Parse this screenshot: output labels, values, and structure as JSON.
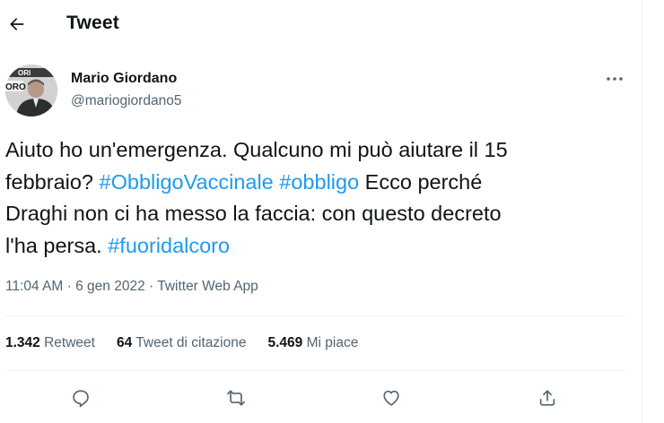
{
  "header": {
    "title": "Tweet",
    "back_icon": "arrow-left-icon"
  },
  "author": {
    "name": "Mario Giordano",
    "handle": "@mariogiordano5",
    "avatar_text_top": "ORI",
    "avatar_text_bottom": "ORO"
  },
  "tweet": {
    "line1": "Aiuto ho un'emergenza. Qualcuno mi può aiutare il 15",
    "line2_pre": "febbraio? ",
    "hashtag1": "#ObbligoVaccinale",
    "hashtag2": "#obbligo",
    "line2_post": " Ecco perché",
    "line3": "Draghi non ci ha messo la faccia: con questo decreto",
    "line4_pre": "l'ha persa. ",
    "hashtag3": "#fuoridalcoro"
  },
  "meta": {
    "time": "11:04 AM",
    "sep1": " · ",
    "date": "6 gen 2022",
    "sep2": " · ",
    "source": "Twitter Web App"
  },
  "stats": {
    "retweets_count": "1.342",
    "retweets_label": "Retweet",
    "quotes_count": "64",
    "quotes_label": "Tweet di citazione",
    "likes_count": "5.469",
    "likes_label": "Mi piace"
  },
  "actions": [
    "reply-icon",
    "retweet-icon",
    "like-icon",
    "share-icon"
  ],
  "colors": {
    "link": "#1d9bf0",
    "secondary_text": "#536471",
    "primary_text": "#0f1419",
    "divider": "#eff3f4"
  }
}
